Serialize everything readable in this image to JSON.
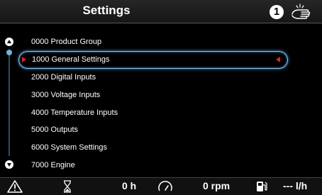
{
  "header": {
    "title": "Settings",
    "info_badge": "1",
    "info_icon": "info-number-icon",
    "hand_icon": "hand-touch-icon"
  },
  "menu": {
    "items": [
      {
        "label": "0000 Product Group"
      },
      {
        "label": "1000 General Settings",
        "selected": true
      },
      {
        "label": "2000 Digital Inputs"
      },
      {
        "label": "3000 Voltage Inputs"
      },
      {
        "label": "4000 Temperature Inputs"
      },
      {
        "label": "5000 Outputs"
      },
      {
        "label": "6000 System Settings"
      },
      {
        "label": "7000 Engine"
      }
    ],
    "scroll_position": 0.0
  },
  "status": {
    "hours_value": "0 h",
    "rpm_value": "0 rpm",
    "fuel_value": "--- l/h",
    "icons": [
      "warning-icon",
      "hourglass-icon",
      "tachometer-icon",
      "fuel-pump-icon"
    ]
  },
  "colors": {
    "selection_border": "#8fc7ea",
    "selection_marker": "#e0202c",
    "scroll_thumb": "#6fb3e4"
  }
}
